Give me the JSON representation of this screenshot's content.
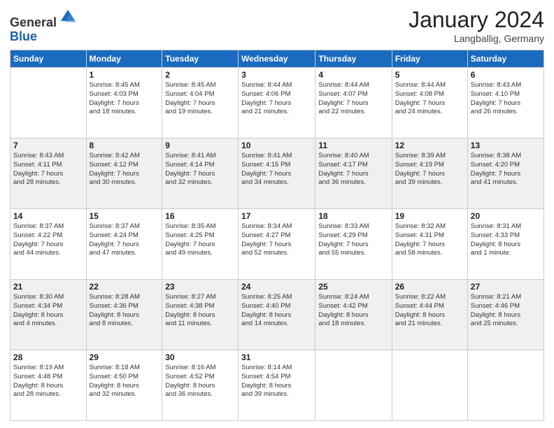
{
  "header": {
    "logo_general": "General",
    "logo_blue": "Blue",
    "month_title": "January 2024",
    "location": "Langballig, Germany"
  },
  "columns": [
    "Sunday",
    "Monday",
    "Tuesday",
    "Wednesday",
    "Thursday",
    "Friday",
    "Saturday"
  ],
  "weeks": [
    [
      {
        "day": "",
        "info": ""
      },
      {
        "day": "1",
        "info": "Sunrise: 8:45 AM\nSunset: 4:03 PM\nDaylight: 7 hours\nand 18 minutes."
      },
      {
        "day": "2",
        "info": "Sunrise: 8:45 AM\nSunset: 4:04 PM\nDaylight: 7 hours\nand 19 minutes."
      },
      {
        "day": "3",
        "info": "Sunrise: 8:44 AM\nSunset: 4:06 PM\nDaylight: 7 hours\nand 21 minutes."
      },
      {
        "day": "4",
        "info": "Sunrise: 8:44 AM\nSunset: 4:07 PM\nDaylight: 7 hours\nand 22 minutes."
      },
      {
        "day": "5",
        "info": "Sunrise: 8:44 AM\nSunset: 4:08 PM\nDaylight: 7 hours\nand 24 minutes."
      },
      {
        "day": "6",
        "info": "Sunrise: 8:43 AM\nSunset: 4:10 PM\nDaylight: 7 hours\nand 26 minutes."
      }
    ],
    [
      {
        "day": "7",
        "info": "Sunrise: 8:43 AM\nSunset: 4:11 PM\nDaylight: 7 hours\nand 28 minutes."
      },
      {
        "day": "8",
        "info": "Sunrise: 8:42 AM\nSunset: 4:12 PM\nDaylight: 7 hours\nand 30 minutes."
      },
      {
        "day": "9",
        "info": "Sunrise: 8:41 AM\nSunset: 4:14 PM\nDaylight: 7 hours\nand 32 minutes."
      },
      {
        "day": "10",
        "info": "Sunrise: 8:41 AM\nSunset: 4:15 PM\nDaylight: 7 hours\nand 34 minutes."
      },
      {
        "day": "11",
        "info": "Sunrise: 8:40 AM\nSunset: 4:17 PM\nDaylight: 7 hours\nand 36 minutes."
      },
      {
        "day": "12",
        "info": "Sunrise: 8:39 AM\nSunset: 4:19 PM\nDaylight: 7 hours\nand 39 minutes."
      },
      {
        "day": "13",
        "info": "Sunrise: 8:38 AM\nSunset: 4:20 PM\nDaylight: 7 hours\nand 41 minutes."
      }
    ],
    [
      {
        "day": "14",
        "info": "Sunrise: 8:37 AM\nSunset: 4:22 PM\nDaylight: 7 hours\nand 44 minutes."
      },
      {
        "day": "15",
        "info": "Sunrise: 8:37 AM\nSunset: 4:24 PM\nDaylight: 7 hours\nand 47 minutes."
      },
      {
        "day": "16",
        "info": "Sunrise: 8:35 AM\nSunset: 4:25 PM\nDaylight: 7 hours\nand 49 minutes."
      },
      {
        "day": "17",
        "info": "Sunrise: 8:34 AM\nSunset: 4:27 PM\nDaylight: 7 hours\nand 52 minutes."
      },
      {
        "day": "18",
        "info": "Sunrise: 8:33 AM\nSunset: 4:29 PM\nDaylight: 7 hours\nand 55 minutes."
      },
      {
        "day": "19",
        "info": "Sunrise: 8:32 AM\nSunset: 4:31 PM\nDaylight: 7 hours\nand 58 minutes."
      },
      {
        "day": "20",
        "info": "Sunrise: 8:31 AM\nSunset: 4:33 PM\nDaylight: 8 hours\nand 1 minute."
      }
    ],
    [
      {
        "day": "21",
        "info": "Sunrise: 8:30 AM\nSunset: 4:34 PM\nDaylight: 8 hours\nand 4 minutes."
      },
      {
        "day": "22",
        "info": "Sunrise: 8:28 AM\nSunset: 4:36 PM\nDaylight: 8 hours\nand 8 minutes."
      },
      {
        "day": "23",
        "info": "Sunrise: 8:27 AM\nSunset: 4:38 PM\nDaylight: 8 hours\nand 11 minutes."
      },
      {
        "day": "24",
        "info": "Sunrise: 8:25 AM\nSunset: 4:40 PM\nDaylight: 8 hours\nand 14 minutes."
      },
      {
        "day": "25",
        "info": "Sunrise: 8:24 AM\nSunset: 4:42 PM\nDaylight: 8 hours\nand 18 minutes."
      },
      {
        "day": "26",
        "info": "Sunrise: 8:22 AM\nSunset: 4:44 PM\nDaylight: 8 hours\nand 21 minutes."
      },
      {
        "day": "27",
        "info": "Sunrise: 8:21 AM\nSunset: 4:46 PM\nDaylight: 8 hours\nand 25 minutes."
      }
    ],
    [
      {
        "day": "28",
        "info": "Sunrise: 8:19 AM\nSunset: 4:48 PM\nDaylight: 8 hours\nand 28 minutes."
      },
      {
        "day": "29",
        "info": "Sunrise: 8:18 AM\nSunset: 4:50 PM\nDaylight: 8 hours\nand 32 minutes."
      },
      {
        "day": "30",
        "info": "Sunrise: 8:16 AM\nSunset: 4:52 PM\nDaylight: 8 hours\nand 36 minutes."
      },
      {
        "day": "31",
        "info": "Sunrise: 8:14 AM\nSunset: 4:54 PM\nDaylight: 8 hours\nand 39 minutes."
      },
      {
        "day": "",
        "info": ""
      },
      {
        "day": "",
        "info": ""
      },
      {
        "day": "",
        "info": ""
      }
    ]
  ]
}
